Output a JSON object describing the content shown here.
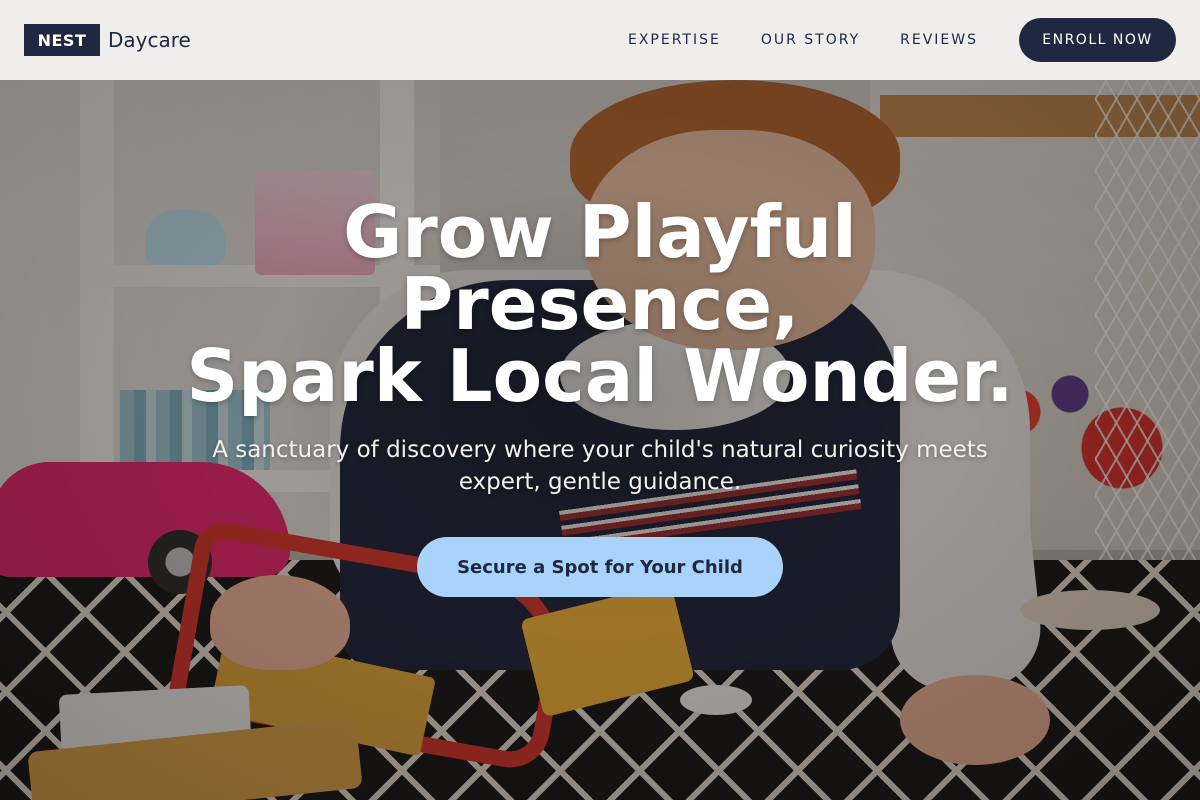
{
  "header": {
    "brand_badge": "NEST",
    "brand_name": "Daycare",
    "nav": [
      {
        "label": "EXPERTISE"
      },
      {
        "label": "OUR STORY"
      },
      {
        "label": "REVIEWS"
      }
    ],
    "enroll_label": "ENROLL NOW"
  },
  "hero": {
    "title_lines": [
      "Grow Playful",
      "Presence,",
      "Spark Local Wonder."
    ],
    "subtitle": "A sanctuary of discovery where your child's natural curiosity meets expert, gentle guidance.",
    "cta_label": "Secure a Spot for Your Child"
  },
  "colors": {
    "brand_navy": "#1f2840",
    "cta_blue": "#a9d3fb",
    "header_bg": "#f7f6f4"
  }
}
